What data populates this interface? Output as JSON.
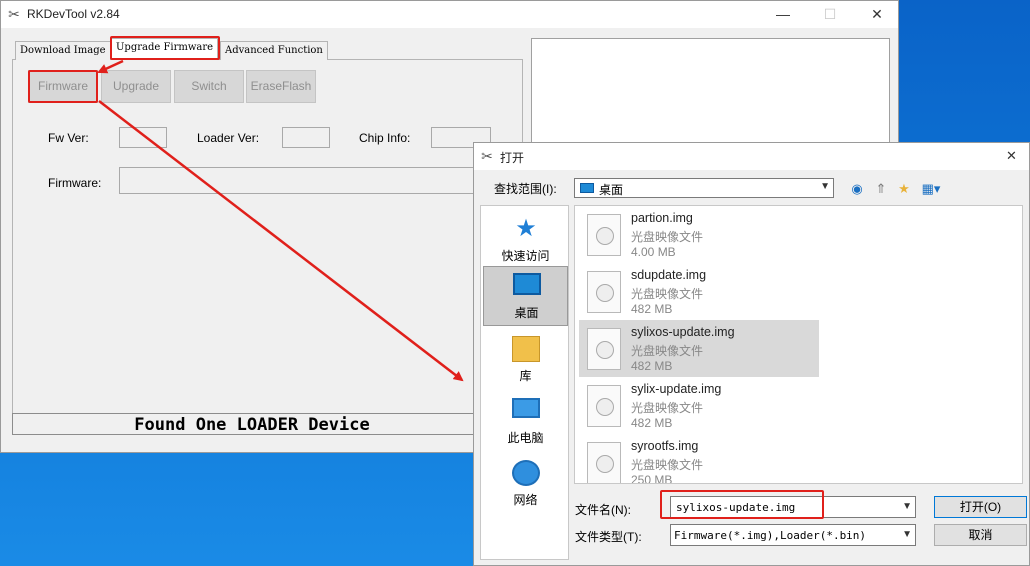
{
  "main": {
    "title": "RKDevTool v2.84",
    "tabs": [
      "Download Image",
      "Upgrade Firmware",
      "Advanced Function"
    ],
    "buttons": [
      "Firmware",
      "Upgrade",
      "Switch",
      "EraseFlash"
    ],
    "labels": {
      "fw_ver": "Fw Ver:",
      "loader_ver": "Loader Ver:",
      "chip_info": "Chip Info:",
      "firmware": "Firmware:"
    },
    "status": "Found One LOADER Device",
    "window_controls": {
      "minimize": "—",
      "maximize": "☐",
      "close": "✕"
    }
  },
  "dialog": {
    "title": "打开",
    "lookin_label": "查找范围(I):",
    "lookin_value": "桌面",
    "places": [
      "快速访问",
      "桌面",
      "库",
      "此电脑",
      "网络"
    ],
    "files": [
      {
        "name": "partion.img",
        "type": "光盘映像文件",
        "size": "4.00 MB"
      },
      {
        "name": "sdupdate.img",
        "type": "光盘映像文件",
        "size": "482 MB"
      },
      {
        "name": "sylixos-update.img",
        "type": "光盘映像文件",
        "size": "482 MB"
      },
      {
        "name": "sylix-update.img",
        "type": "光盘映像文件",
        "size": "482 MB"
      },
      {
        "name": "syrootfs.img",
        "type": "光盘映像文件",
        "size": "250 MB"
      }
    ],
    "filename_label": "文件名(N):",
    "filename_value": "sylixos-update.img",
    "filetype_label": "文件类型(T):",
    "filetype_value": "Firmware(*.img),Loader(*.bin)",
    "open_button": "打开(O)",
    "cancel_button": "取消",
    "close": "✕"
  },
  "colors": {
    "highlight": "#e0201b",
    "desktop": "#0f78d8"
  }
}
